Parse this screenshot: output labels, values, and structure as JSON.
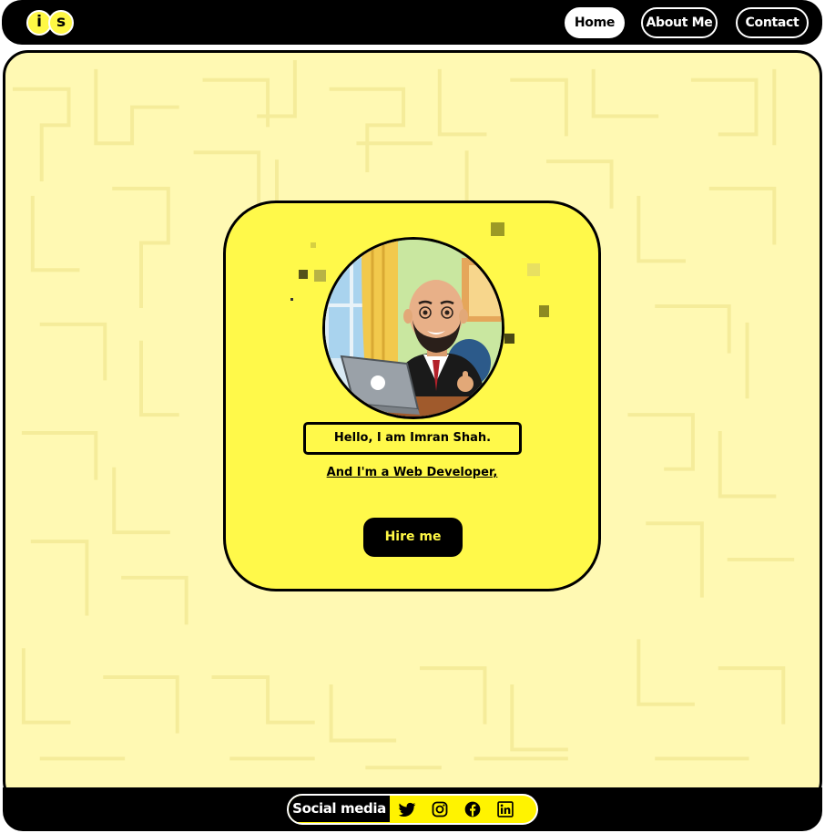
{
  "navbar": {
    "logo_i": "i",
    "logo_s": "s",
    "links": [
      {
        "label": "Home",
        "active": true
      },
      {
        "label": "About Me",
        "active": false
      },
      {
        "label": "Contact",
        "active": false
      }
    ]
  },
  "hero": {
    "greeting": "Hello, I am Imran Shah.",
    "role": "And I'm a Web Developer,",
    "hire_label": "Hire me",
    "avatar_icon": "bitmoji-avatar"
  },
  "footer": {
    "social_label": "Social media",
    "icons": [
      "twitter-icon",
      "instagram-icon",
      "facebook-icon",
      "linkedin-icon"
    ]
  },
  "colors": {
    "accent_yellow": "#fff94a",
    "background_yellow": "#fff9b3",
    "black": "#000000"
  }
}
